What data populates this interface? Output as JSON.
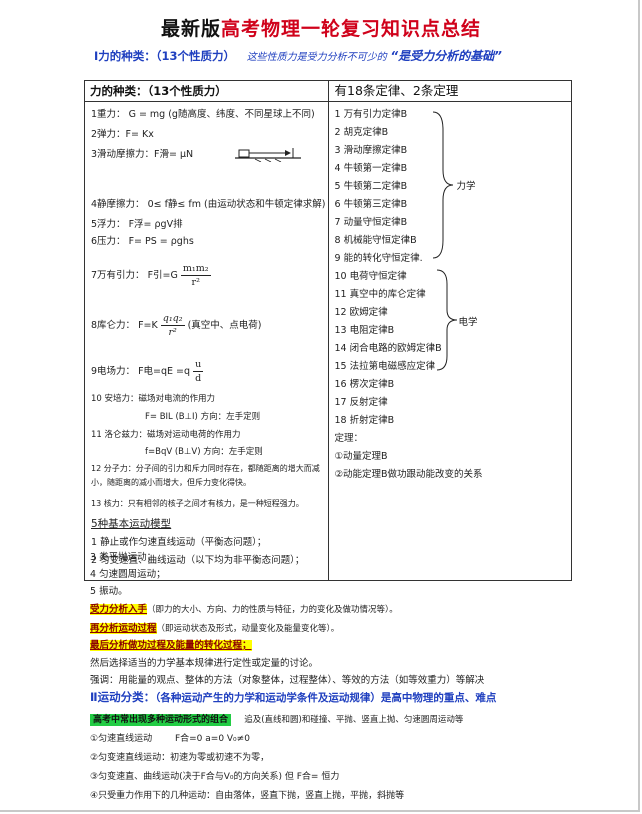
{
  "doc": {
    "title_black": "最新版",
    "title_red": "高考物理一轮复习知识点总结",
    "section1_heading": "Ⅰ力的种类：（13个性质力）",
    "section1_note": "这些性质力是受力分析不可少的",
    "section1_emph": "“是受力分析的基础”"
  },
  "table": {
    "left_header": "力的种类：（13个性质力）",
    "right_header": "有18条定律、2条定理",
    "forces": [
      "1重力：  G = mg  (g随高度、纬度、不同星球上不同)",
      "2弹力：F= Kx",
      "3滑动摩擦力：F滑= μN",
      "4静摩擦力：   0≤ f静≤ fm (由运动状态和牛顿定律求解)",
      "5浮力：  F浮= ρgV排",
      "6压力：  F= PS = ρghs",
      "7万有引力：   F引=G",
      "8库仑力：   F=K",
      "(真空中、点电荷)",
      "9电场力：   F电=qE =q",
      "10 安培力：磁场对电流的作用力",
      "F= BIL  (B⊥I)   方向：左手定则",
      "11 洛仑兹力：磁场对运动电荷的作用力",
      "f=BqV  (B⊥V)    方向：左手定则",
      "12 分子力：分子间的引力和斥力同时存在，都随距离的增大而减小，随距离的减小而增大，但斥力变化得快。",
      "13 核力：只有相邻的核子之间才有核力，是一种短程强力。"
    ],
    "formula_parts": {
      "grav_num": "m₁m₂",
      "grav_den": "r²",
      "coul_num": "q₁q₂",
      "coul_den": "r²",
      "elec_num": "u",
      "elec_den": "d"
    },
    "motion_heading": "5种基本运动模型",
    "motions": [
      "1 静止或作匀速直线运动（平衡态问题）；",
      "2 匀变速直、曲线运动（以下均为非平衡态问题）；",
      "3 类平抛运动；",
      "4 匀速圆周运动；",
      "5 振动。"
    ],
    "laws": [
      "1 万有引力定律B",
      "2 胡克定律B",
      "3 滑动摩擦定律B",
      "4 牛顿第一定律B",
      "5 牛顿第二定律B",
      "6 牛顿第三定律B",
      "7 动量守恒定律B",
      "8 机械能守恒定律B",
      "9 能的转化守恒定律.",
      "10 电荷守恒定律",
      "11 真空中的库仑定律",
      "12 欧姆定律",
      "13 电阻定律B",
      "14 闭合电路的欧姆定律B",
      "15 法拉第电磁感应定律",
      "16 楞次定律B",
      "17 反射定律",
      "18 折射定律B"
    ],
    "mech_label": "力学",
    "elec_label": "电学",
    "theorem_heading": "定理：",
    "theorems": [
      "①动量定理B",
      "②动能定理B做功跟动能改变的关系"
    ]
  },
  "below": {
    "step1_label": "受力分析入手",
    "step1_text": "（即力的大小、方向、力的性质与特征，力的变化及做功情况等）。",
    "step2_label": "再分析运动过程",
    "step2_text": "（即运动状态及形式，动量变化及能量变化等）。",
    "step3_label": "最后分析做功过程及能量的转化过程；",
    "line4": "然后选择适当的力学基本规律进行定性或定量的讨论。",
    "line5": "强调：用能量的观点、整体的方法（对象整体，过程整体）、等效的方法（如等效重力）等解决",
    "section2_heading": "Ⅱ运动分类：",
    "section2_emph": "（各种运动产生的力学和运动学条件及运动规律）是高中物理的重点、难点",
    "green_label": "高考中常出现多种运动形式的组合",
    "green_text": "追及(直线和圆)和碰撞、平抛、竖直上抛、匀速圆周运动等",
    "m1": "①匀速直线运动",
    "m1b": "F合=0     a=0     V₀≠0",
    "m2": "②匀变速直线运动：初速为零或初速不为零，",
    "m3": "③匀变速直、曲线运动(决于F合与V₀的方向关系) 但 F合= 恒力",
    "m4": "④只受重力作用下的几种运动：自由落体，竖直下抛，竖直上抛，平抛，斜抛等"
  }
}
